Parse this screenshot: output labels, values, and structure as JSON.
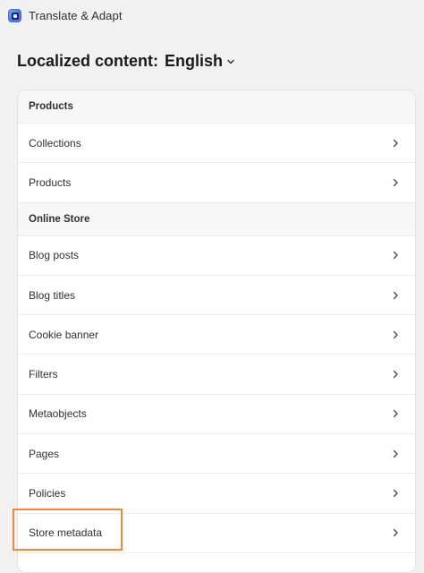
{
  "app": {
    "title": "Translate & Adapt"
  },
  "header": {
    "title": "Localized content:",
    "language": "English"
  },
  "sections": [
    {
      "heading": "Products",
      "items": [
        "Collections",
        "Products"
      ]
    },
    {
      "heading": "Online Store",
      "items": [
        "Blog posts",
        "Blog titles",
        "Cookie banner",
        "Filters",
        "Metaobjects",
        "Pages",
        "Policies",
        "Store metadata"
      ]
    }
  ],
  "highlight": {
    "target": "Store metadata",
    "color": "#f0883e"
  }
}
